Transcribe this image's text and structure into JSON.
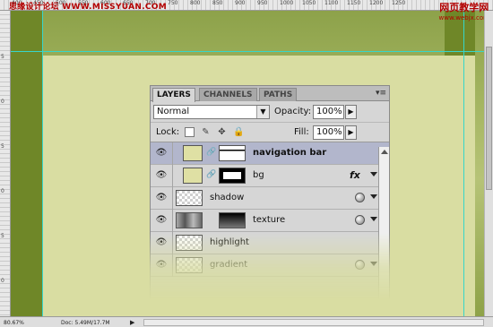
{
  "watermark": {
    "left": "思缘设计论坛 WWW.MISSYUAN.COM",
    "right_top": "网页教学网",
    "right_bottom": "www.webjx.com"
  },
  "ruler": {
    "top_ticks": [
      "400",
      "450",
      "500",
      "550",
      "600",
      "650",
      "700",
      "750",
      "800",
      "850",
      "900",
      "950",
      "1000",
      "1050",
      "1100",
      "1150",
      "1200",
      "1250"
    ],
    "left_ticks": [
      "5",
      "0",
      "5",
      "0",
      "5",
      "0"
    ]
  },
  "statusbar": {
    "zoom": "80.67%",
    "doc": "Doc: 5.49M/17.7M",
    "arrow": "▶"
  },
  "panel": {
    "tabs": [
      "LAYERS",
      "CHANNELS",
      "PATHS"
    ],
    "active_tab": "LAYERS",
    "menu_icon": "▾≡",
    "blend_mode": "Normal",
    "opacity_label": "Opacity:",
    "opacity_value": "100%",
    "lock_label": "Lock:",
    "fill_label": "Fill:",
    "fill_value": "100%",
    "layers": [
      {
        "name": "navigation bar",
        "selected": true,
        "bold": true
      },
      {
        "name": "bg",
        "fx": "fx"
      },
      {
        "name": "shadow"
      },
      {
        "name": "texture"
      },
      {
        "name": "highlight"
      },
      {
        "name": "gradient"
      }
    ]
  },
  "icons": {
    "eye": "eye-icon",
    "link": "link-icon",
    "dropdown": "chevron-down-icon"
  },
  "colors": {
    "canvas_green": "#6f8728",
    "canvas_light": "#d9dda2",
    "guide": "#37d6c9",
    "selected_layer": "#b2b6cc"
  }
}
